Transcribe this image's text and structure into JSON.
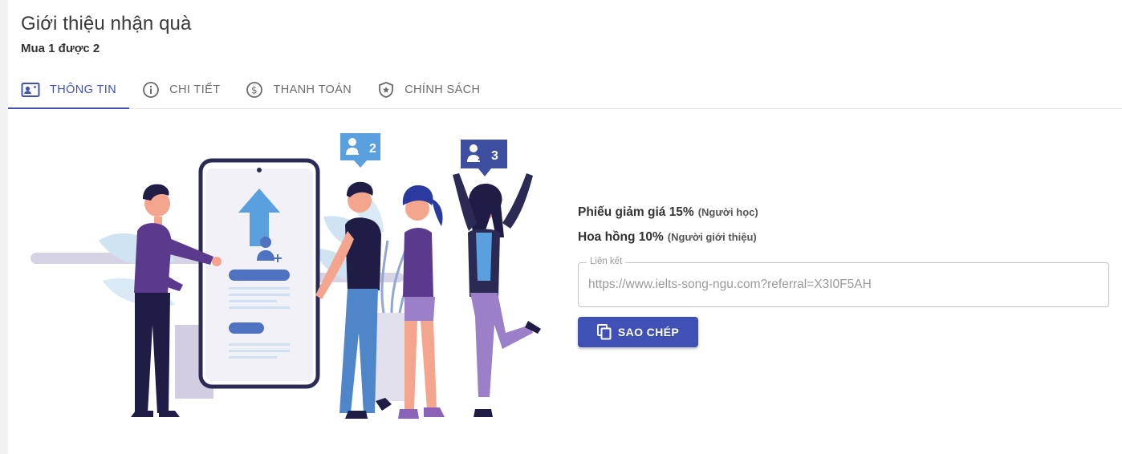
{
  "header": {
    "title": "Giới thiệu nhận quà",
    "subtitle": "Mua 1 được 2"
  },
  "tabs": [
    {
      "label": "THÔNG TIN",
      "icon": "id-card-icon",
      "active": true
    },
    {
      "label": "CHI TIẾT",
      "icon": "info-icon",
      "active": false
    },
    {
      "label": "THANH TOÁN",
      "icon": "dollar-icon",
      "active": false
    },
    {
      "label": "CHÍNH SÁCH",
      "icon": "shield-star-icon",
      "active": false
    }
  ],
  "illustration": {
    "badge_left": "2",
    "badge_right": "3"
  },
  "info": {
    "discount_label": "Phiếu giảm giá 15%",
    "discount_note": "(Người học)",
    "commission_label": "Hoa hồng 10%",
    "commission_note": "(Người giới thiệu)",
    "link_label": "Liên kết",
    "link_value": "https://www.ielts-song-ngu.com?referral=X3I0F5AH",
    "copy_button": "SAO CHÉP"
  },
  "colors": {
    "accent": "#3f51b5",
    "tab_text": "#6b6b6b"
  }
}
